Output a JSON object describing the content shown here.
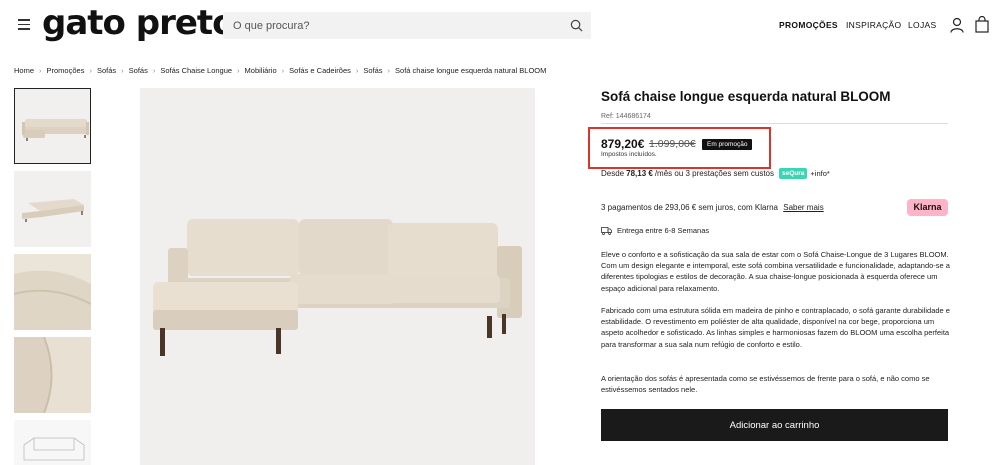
{
  "header": {
    "logo": "gato preto",
    "search_placeholder": "O que procura?",
    "nav": [
      "PROMOÇÕES",
      "INSPIRAÇÃO",
      "LOJAS"
    ]
  },
  "breadcrumb": [
    "Home",
    "Promoções",
    "Sofás",
    "Sofás",
    "Sofás Chaise Longue",
    "Mobiliário",
    "Sofás e Cadeirões",
    "Sofás",
    "Sofá chaise longue esquerda natural BLOOM"
  ],
  "product": {
    "title": "Sofá chaise longue esquerda natural BLOOM",
    "ref": "Ref: 144686174",
    "price": "879,20€",
    "old_price": "1.099,00€",
    "badge": "Em promoção",
    "tax_note": "Impostos incluídos.",
    "installment_prefix": "Desde",
    "installment_amount": "78,13 €",
    "installment_suffix": "/mês ou 3 prestações sem custos",
    "sequra_label": "seQura",
    "info_link": "+info*",
    "klarna_text": "3 pagamentos de 293,06 € sem juros, com Klarna",
    "klarna_link": "Saber mais",
    "klarna_logo": "Klarna",
    "delivery": "Entrega entre 6-8 Semanas",
    "description": [
      "Eleve o conforto e a sofisticação da sua sala de estar com o Sofá Chaise-Longue de 3 Lugares BLOOM. Com um design elegante e intemporal, este sofá combina versatilidade e funcionalidade, adaptando-se a diferentes tipologias e estilos de decoração. A sua chaise-longue posicionada à esquerda oferece um espaço adicional para relaxamento.",
      "Fabricado com uma estrutura sólida em madeira de pinho e contraplacado, o sofá garante durabilidade e estabilidade. O revestimento em poliéster de alta qualidade, disponível na cor bege, proporciona um aspeto acolhedor e sofisticado. As linhas simples e harmoniosas fazem do BLOOM uma escolha perfeita para transformar a sua sala num refúgio de conforto e estilo.",
      "A orientação dos sofás é apresentada como se estivéssemos de frente para o sofá, e não como se estivéssemos sentados nele."
    ],
    "add_to_cart": "Adicionar ao carrinho"
  },
  "colors": {
    "highlight_border": "#d9362b",
    "sequra": "#3bd6b1",
    "klarna": "#ffb3c7",
    "button": "#1a1a1a",
    "sofa_fabric": "#e4dacb"
  }
}
